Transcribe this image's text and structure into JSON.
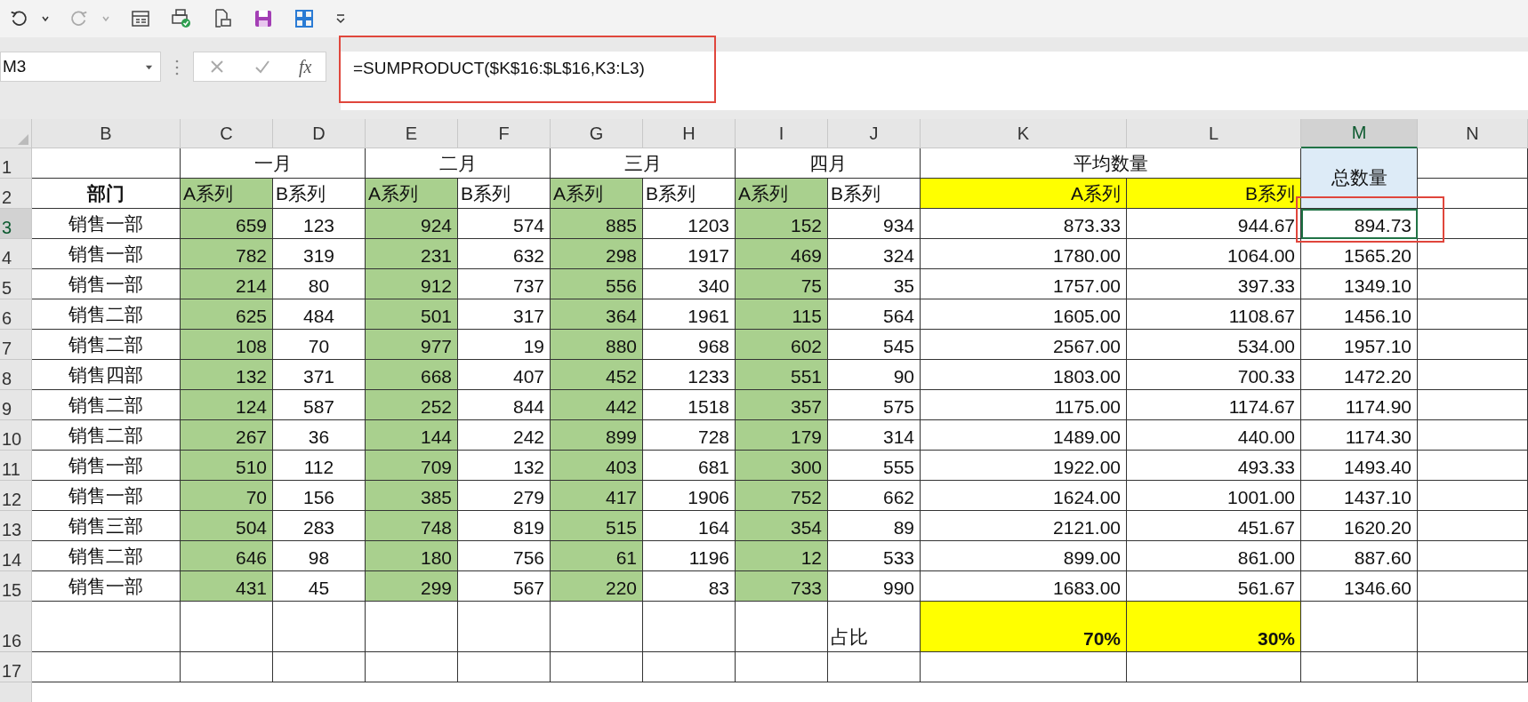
{
  "name_box": {
    "value": "M3"
  },
  "formula_bar": {
    "fx": "fx",
    "formula": "=SUMPRODUCT($K$16:$L$16,K3:L3)"
  },
  "columns": [
    {
      "label": "B",
      "selected": false
    },
    {
      "label": "C",
      "selected": false
    },
    {
      "label": "D",
      "selected": false
    },
    {
      "label": "E",
      "selected": false
    },
    {
      "label": "F",
      "selected": false
    },
    {
      "label": "G",
      "selected": false
    },
    {
      "label": "H",
      "selected": false
    },
    {
      "label": "I",
      "selected": false
    },
    {
      "label": "J",
      "selected": false
    },
    {
      "label": "K",
      "selected": false
    },
    {
      "label": "L",
      "selected": false
    },
    {
      "label": "M",
      "selected": true
    },
    {
      "label": "N",
      "selected": false
    }
  ],
  "row_headers": [
    {
      "label": "1",
      "selected": false
    },
    {
      "label": "2",
      "selected": false
    },
    {
      "label": "3",
      "selected": true
    },
    {
      "label": "4",
      "selected": false
    },
    {
      "label": "5",
      "selected": false
    },
    {
      "label": "6",
      "selected": false
    },
    {
      "label": "7",
      "selected": false
    },
    {
      "label": "8",
      "selected": false
    },
    {
      "label": "9",
      "selected": false
    },
    {
      "label": "10",
      "selected": false
    },
    {
      "label": "11",
      "selected": false
    },
    {
      "label": "12",
      "selected": false
    },
    {
      "label": "13",
      "selected": false
    },
    {
      "label": "14",
      "selected": false
    },
    {
      "label": "15",
      "selected": false
    },
    {
      "label": "16",
      "selected": false
    },
    {
      "label": "17",
      "selected": false
    }
  ],
  "month_headers": [
    "一月",
    "二月",
    "三月",
    "四月"
  ],
  "average_header": "平均数量",
  "total_header": "总数量",
  "header_row": [
    "部门",
    "A系列",
    "B系列",
    "A系列",
    "B系列",
    "A系列",
    "B系列",
    "A系列",
    "B系列",
    "A系列",
    "B系列"
  ],
  "rows": [
    [
      "销售一部",
      "659",
      "123",
      "924",
      "574",
      "885",
      "1203",
      "152",
      "934",
      "873.33",
      "944.67",
      "894.73"
    ],
    [
      "销售一部",
      "782",
      "319",
      "231",
      "632",
      "298",
      "1917",
      "469",
      "324",
      "1780.00",
      "1064.00",
      "1565.20"
    ],
    [
      "销售一部",
      "214",
      "80",
      "912",
      "737",
      "556",
      "340",
      "75",
      "35",
      "1757.00",
      "397.33",
      "1349.10"
    ],
    [
      "销售二部",
      "625",
      "484",
      "501",
      "317",
      "364",
      "1961",
      "115",
      "564",
      "1605.00",
      "1108.67",
      "1456.10"
    ],
    [
      "销售二部",
      "108",
      "70",
      "977",
      "19",
      "880",
      "968",
      "602",
      "545",
      "2567.00",
      "534.00",
      "1957.10"
    ],
    [
      "销售四部",
      "132",
      "371",
      "668",
      "407",
      "452",
      "1233",
      "551",
      "90",
      "1803.00",
      "700.33",
      "1472.20"
    ],
    [
      "销售二部",
      "124",
      "587",
      "252",
      "844",
      "442",
      "1518",
      "357",
      "575",
      "1175.00",
      "1174.67",
      "1174.90"
    ],
    [
      "销售二部",
      "267",
      "36",
      "144",
      "242",
      "899",
      "728",
      "179",
      "314",
      "1489.00",
      "440.00",
      "1174.30"
    ],
    [
      "销售一部",
      "510",
      "112",
      "709",
      "132",
      "403",
      "681",
      "300",
      "555",
      "1922.00",
      "493.33",
      "1493.40"
    ],
    [
      "销售一部",
      "70",
      "156",
      "385",
      "279",
      "417",
      "1906",
      "752",
      "662",
      "1624.00",
      "1001.00",
      "1437.10"
    ],
    [
      "销售三部",
      "504",
      "283",
      "748",
      "819",
      "515",
      "164",
      "354",
      "89",
      "2121.00",
      "451.67",
      "1620.20"
    ],
    [
      "销售二部",
      "646",
      "98",
      "180",
      "756",
      "61",
      "1196",
      "12",
      "533",
      "899.00",
      "861.00",
      "887.60"
    ],
    [
      "销售一部",
      "431",
      "45",
      "299",
      "567",
      "220",
      "83",
      "733",
      "990",
      "1683.00",
      "561.67",
      "1346.60"
    ]
  ],
  "summary_row": {
    "label": "占比",
    "shares": [
      "70%",
      "30%"
    ]
  }
}
